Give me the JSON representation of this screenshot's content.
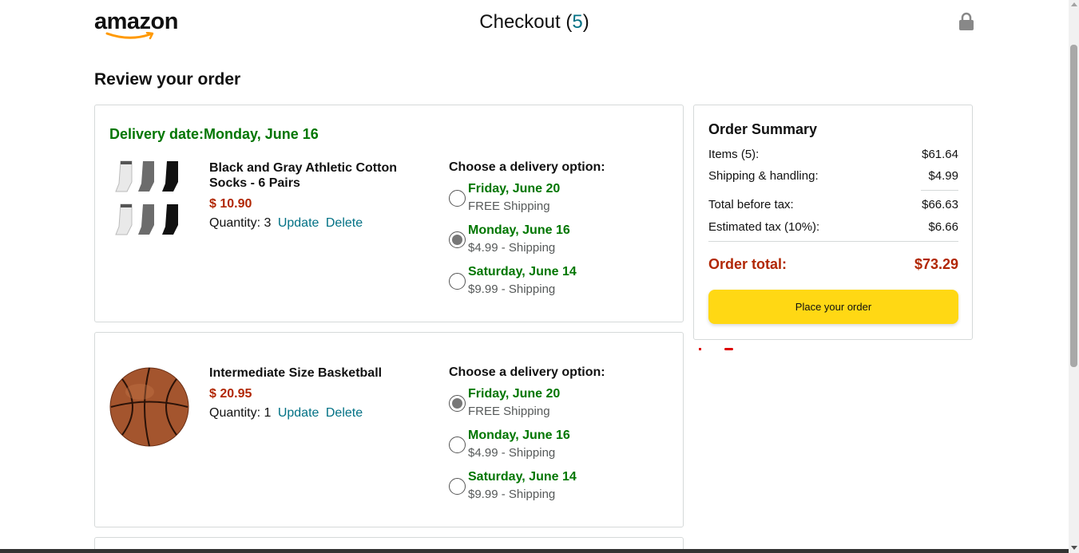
{
  "header": {
    "logo_text": "amazon",
    "checkout_label": "Checkout",
    "checkout_count": "5"
  },
  "review_title": "Review your order",
  "orders": [
    {
      "delivery_date": "Delivery date:Monday, June 16",
      "product_name": "Black and Gray Athletic Cotton Socks - 6 Pairs",
      "price": "$ 10.90",
      "quantity_text": "Quantity: 3",
      "update_label": "Update",
      "delete_label": "Delete",
      "options_title": "Choose a delivery option:",
      "options": [
        {
          "date": "Friday, June 20",
          "shipping": "FREE Shipping",
          "selected": false
        },
        {
          "date": "Monday, June 16",
          "shipping": "$4.99 - Shipping",
          "selected": true
        },
        {
          "date": "Saturday, June 14",
          "shipping": "$9.99 - Shipping",
          "selected": false
        }
      ]
    },
    {
      "delivery_date": "",
      "product_name": "Intermediate Size Basketball",
      "price": "$ 20.95",
      "quantity_text": "Quantity: 1",
      "update_label": "Update",
      "delete_label": "Delete",
      "options_title": "Choose a delivery option:",
      "options": [
        {
          "date": "Friday, June 20",
          "shipping": "FREE Shipping",
          "selected": true
        },
        {
          "date": "Monday, June 16",
          "shipping": "$4.99 - Shipping",
          "selected": false
        },
        {
          "date": "Saturday, June 14",
          "shipping": "$9.99 - Shipping",
          "selected": false
        }
      ]
    }
  ],
  "summary": {
    "title": "Order Summary",
    "items_label": "Items (5):",
    "items_value": "$61.64",
    "shipping_label": "Shipping & handling:",
    "shipping_value": "$4.99",
    "before_tax_label": "Total before tax:",
    "before_tax_value": "$66.63",
    "tax_label": "Estimated tax (10%):",
    "tax_value": "$6.66",
    "total_label": "Order total:",
    "total_value": "$73.29",
    "place_order_label": "Place your order"
  },
  "colors": {
    "accent_green": "#007600",
    "price_red": "#b12704",
    "link_teal": "#017185",
    "button_yellow": "#ffd814"
  }
}
